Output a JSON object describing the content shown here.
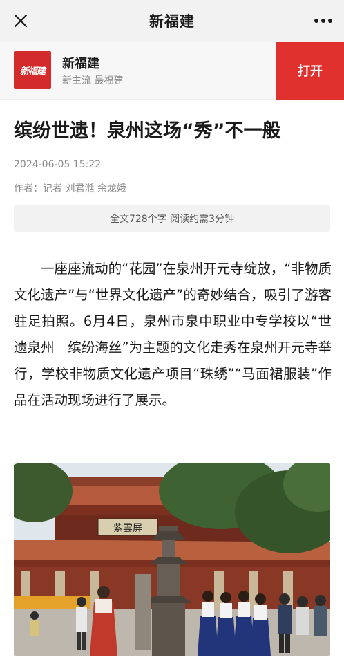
{
  "topbar": {
    "title": "新福建",
    "close_icon": "close-icon",
    "more_icon": "more-dots-icon"
  },
  "appbar": {
    "logo_text": "新福建",
    "name": "新福建",
    "slogan": "新主流 最福建",
    "open_label": "打开",
    "accent_color": "#e0312f"
  },
  "article": {
    "headline": "缤纷世遗！泉州这场“秀”不一般",
    "datetime": "2024-06-05 15:22",
    "author": "作者：记者 刘君湉 余龙娥",
    "read_info": "全文728个字 阅读约需3分钟",
    "paragraph": "一座座流动的“花园”在泉州开元寺绽放，“非物质文化遗产”与“世界文化遗产”的奇妙结合，吸引了游客驻足拍照。6月4日，泉州市泉中职业中专学校以“世遗泉州　缤纷海丝”为主题的文化走秀在泉州开元寺举行，学校非物质文化遗产项目“珠绣”“马面裙服装”作品在活动现场进行了展示。",
    "photo_plaque": "紫雲屏"
  }
}
